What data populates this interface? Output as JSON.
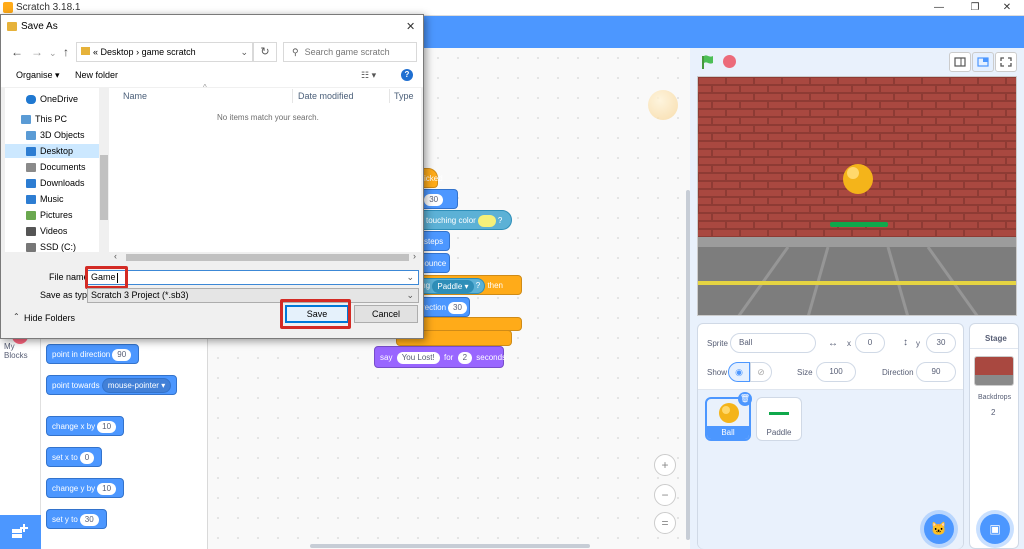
{
  "app": {
    "title": "Scratch 3.18.1",
    "minimize": "—",
    "restore": "❐",
    "close": "✕"
  },
  "palette": {
    "category_label": "My Blocks",
    "blocks": [
      {
        "pre": "point in direction",
        "val": "90"
      },
      {
        "pre": "point towards",
        "dropdown": "mouse-pointer ▾"
      },
      {
        "pre": "change x by",
        "val": "10"
      },
      {
        "pre": "set x to",
        "val": "0"
      },
      {
        "pre": "change y by",
        "val": "10"
      },
      {
        "pre": "set y to",
        "val": "30"
      }
    ]
  },
  "script": {
    "hat_text": "icked",
    "y_label": "y:",
    "y_value": "30",
    "touching_color": "touching color",
    "question": "?",
    "steps": "steps",
    "bounce": "bounce",
    "touching": "ching",
    "touching_target": "Paddle ▾",
    "touching_q": "?",
    "then": "then",
    "direction": "rection",
    "direction_val": "30",
    "say": "say",
    "say_text": "You Lost!",
    "for": "for",
    "for_val": "2",
    "seconds": "seconds"
  },
  "zoom": {
    "in": "+",
    "out": "−",
    "reset": "="
  },
  "sprite_info": {
    "sprite_label": "Sprite",
    "sprite_name": "Ball",
    "x_label": "x",
    "x_value": "0",
    "y_label": "y",
    "y_value": "30",
    "show_label": "Show",
    "size_label": "Size",
    "size_value": "100",
    "direction_label": "Direction",
    "direction_value": "90"
  },
  "sprites": [
    {
      "name": "Ball",
      "selected": true
    },
    {
      "name": "Paddle",
      "selected": false
    }
  ],
  "stage_pane": {
    "title": "Stage",
    "backdrops_label": "Backdrops",
    "backdrops_count": "2"
  },
  "dialog": {
    "title": "Save As",
    "close": "✕",
    "breadcrumb": [
      "«",
      "Desktop",
      "›",
      "game scratch"
    ],
    "search_placeholder": "Search game scratch",
    "organise": "Organise ▾",
    "new_folder": "New folder",
    "nav_items": [
      {
        "label": "OneDrive",
        "color": "#1f78d1"
      },
      {
        "label": "This PC",
        "color": "#5a9bd5"
      },
      {
        "label": "3D Objects",
        "color": "#5a9bd5"
      },
      {
        "label": "Desktop",
        "color": "#2d7dd2",
        "selected": true
      },
      {
        "label": "Documents",
        "color": "#8a8a8a"
      },
      {
        "label": "Downloads",
        "color": "#2d7dd2"
      },
      {
        "label": "Music",
        "color": "#2d7dd2"
      },
      {
        "label": "Pictures",
        "color": "#6aa84f"
      },
      {
        "label": "Videos",
        "color": "#555555"
      },
      {
        "label": "SSD (C:)",
        "color": "#777777"
      }
    ],
    "columns": [
      "Name",
      "Date modified",
      "Type"
    ],
    "empty_message": "No items match your search.",
    "file_name_label": "File name:",
    "file_name_value": "Game",
    "save_type_label": "Save as type:",
    "save_type_value": "Scratch 3 Project (*.sb3)",
    "hide_folders": "Hide Folders",
    "save": "Save",
    "cancel": "Cancel"
  },
  "colors": {
    "scratch_blue": "#4c97ff",
    "highlight": "#d32b25"
  }
}
